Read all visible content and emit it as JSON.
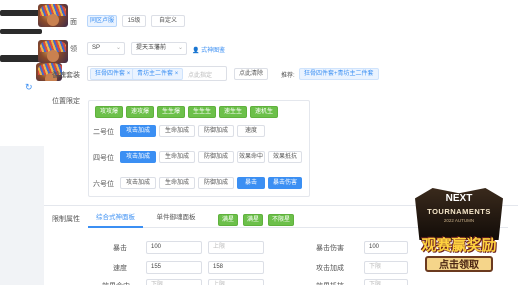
{
  "colors": {
    "accent": "#3b8ff3",
    "green": "#6cc04a",
    "panel": "#ffffff",
    "bg": "#f1f3f6"
  },
  "row1": {
    "label_tail": "面",
    "btn_a": "同区卢服",
    "btn_b": "15级",
    "btn_c": "自定义"
  },
  "row2": {
    "label_tail": "领",
    "select_a": "SP",
    "select_b": "提天玉藩前",
    "link": "式神图鉴"
  },
  "row3": {
    "label": "御魂套装",
    "tag_a": "狂骨四件套",
    "tag_b": "青坊主二件套",
    "btn_placeholder": "点此指定",
    "btn_clear": "点此清除",
    "tip_prefix": "推荐:",
    "tip_value": "狂骨四件套+青坊主二件套"
  },
  "sidebar": {
    "refresh_icon": "refresh-icon"
  },
  "position": {
    "label": "位置限定",
    "quick": [
      "攻攻爆",
      "速攻爆",
      "生生爆",
      "生生生",
      "速生生",
      "速机生"
    ],
    "rows": [
      {
        "label": "二号位",
        "options": [
          "攻击加成",
          "生命加成",
          "防御加成",
          "速度"
        ],
        "active": [
          0
        ]
      },
      {
        "label": "四号位",
        "options": [
          "攻击加成",
          "生命加成",
          "防御加成",
          "效果命中",
          "效果抵抗"
        ],
        "active": [
          0
        ]
      },
      {
        "label": "六号位",
        "options": [
          "攻击加成",
          "生命加成",
          "防御加成",
          "暴击",
          "暴击伤害"
        ],
        "active": [
          3,
          4
        ]
      }
    ]
  },
  "limit": {
    "label": "限制属性",
    "tabs": [
      "综合式神面板",
      "单件御魂面板"
    ],
    "modes": [
      "满星",
      "满星",
      "不限星"
    ],
    "left_rows": [
      {
        "label": "暴击",
        "min": "100",
        "max": "上限"
      },
      {
        "label": "速度",
        "min": "155",
        "max": "158"
      },
      {
        "label": "效果命中",
        "min": "下限",
        "max": "上限"
      }
    ],
    "right_rows": [
      {
        "label": "暴击伤害",
        "min": "100",
        "max": ""
      },
      {
        "label": "攻击加成",
        "min": "下限",
        "max": ""
      },
      {
        "label": "效果抵抗",
        "min": "下限",
        "max": ""
      }
    ]
  },
  "promo": {
    "line1": "NEXT",
    "line2": "TOURNAMENTS",
    "line3": "2022 AUTUMN",
    "line4": "观赛赢奖励",
    "cta": "点击领取"
  }
}
